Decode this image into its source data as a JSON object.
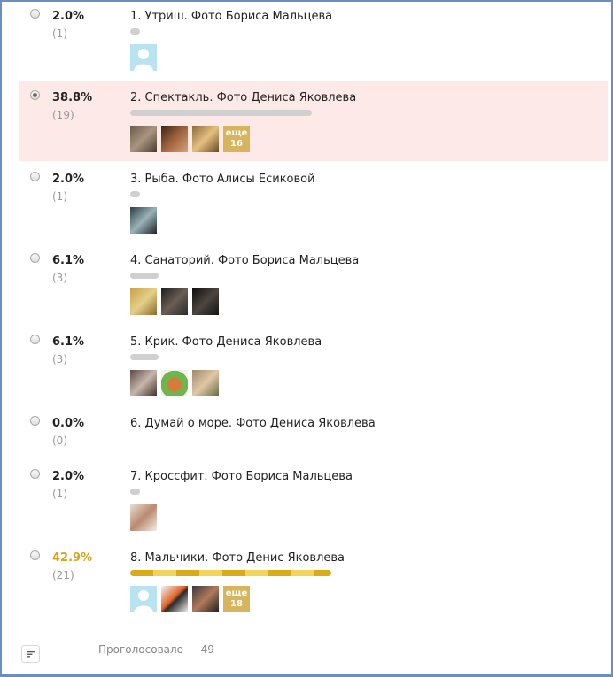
{
  "poll": {
    "options": [
      {
        "pct": "2.0%",
        "count": "(1)",
        "title": "1. Утриш. Фото Бориса Мальцева",
        "share": 0.02
      },
      {
        "pct": "38.8%",
        "count": "(19)",
        "title": "2. Спектакль. Фото Дениса Яковлева",
        "share": 0.388,
        "more_label": "еще",
        "more_count": "16"
      },
      {
        "pct": "2.0%",
        "count": "(1)",
        "title": "3. Рыба. Фото Алисы Есиковой",
        "share": 0.02
      },
      {
        "pct": "6.1%",
        "count": "(3)",
        "title": "4. Санаторий. Фото Бориса Мальцева",
        "share": 0.061
      },
      {
        "pct": "6.1%",
        "count": "(3)",
        "title": "5. Крик. Фото Дениса Яковлева",
        "share": 0.061
      },
      {
        "pct": "0.0%",
        "count": "(0)",
        "title": "6. Думай о море. Фото Дениса Яковлева",
        "share": 0.0
      },
      {
        "pct": "2.0%",
        "count": "(1)",
        "title": "7. Кроссфит. Фото Бориса Мальцева",
        "share": 0.02
      },
      {
        "pct": "42.9%",
        "count": "(21)",
        "title": "8. Мальчики. Фото Денис Яковлева",
        "share": 0.429,
        "more_label": "еще",
        "more_count": "18"
      }
    ],
    "selected_option": 2,
    "leader_option": 8,
    "total_label": "Проголосовало — 49",
    "colors": {
      "leader": "#d6a61c",
      "selected_bg": "#fde9e7",
      "bar": "#d0d0d0",
      "more_badge": "#d8b45c",
      "border": "#6b8fbf"
    }
  }
}
